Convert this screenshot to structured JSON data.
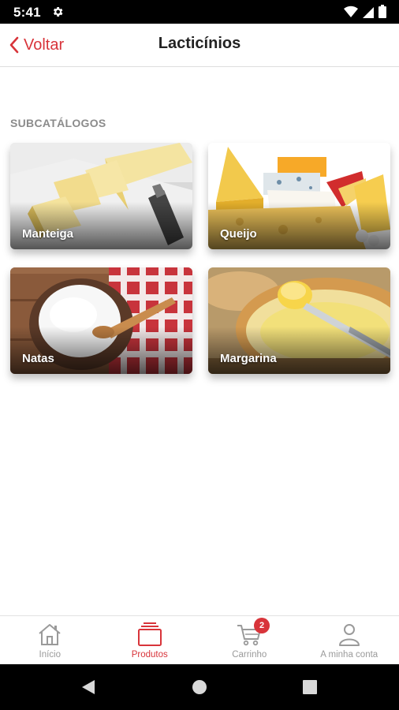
{
  "status_bar": {
    "time": "5:41",
    "icons": [
      "settings-gear-icon",
      "wifi-icon",
      "signal-icon",
      "battery-icon"
    ]
  },
  "header": {
    "back_label": "Voltar",
    "title": "Lacticínios"
  },
  "section": {
    "title": "SUBCATÁLOGOS"
  },
  "subcatalogs": [
    {
      "label": "Manteiga",
      "image": "butter-sticks"
    },
    {
      "label": "Queijo",
      "image": "cheese-assortment"
    },
    {
      "label": "Natas",
      "image": "cream-bowl"
    },
    {
      "label": "Margarina",
      "image": "bread-with-margarine"
    }
  ],
  "bottom_nav": {
    "items": [
      {
        "label": "Início",
        "icon": "home-icon",
        "active": false
      },
      {
        "label": "Produtos",
        "icon": "products-icon",
        "active": true
      },
      {
        "label": "Carrinho",
        "icon": "cart-icon",
        "active": false,
        "badge": "2"
      },
      {
        "label": "A minha conta",
        "icon": "user-icon",
        "active": false
      }
    ]
  },
  "colors": {
    "accent": "#d8343a",
    "inactive": "#9a9a9a",
    "section_title": "#8b8b8b"
  }
}
